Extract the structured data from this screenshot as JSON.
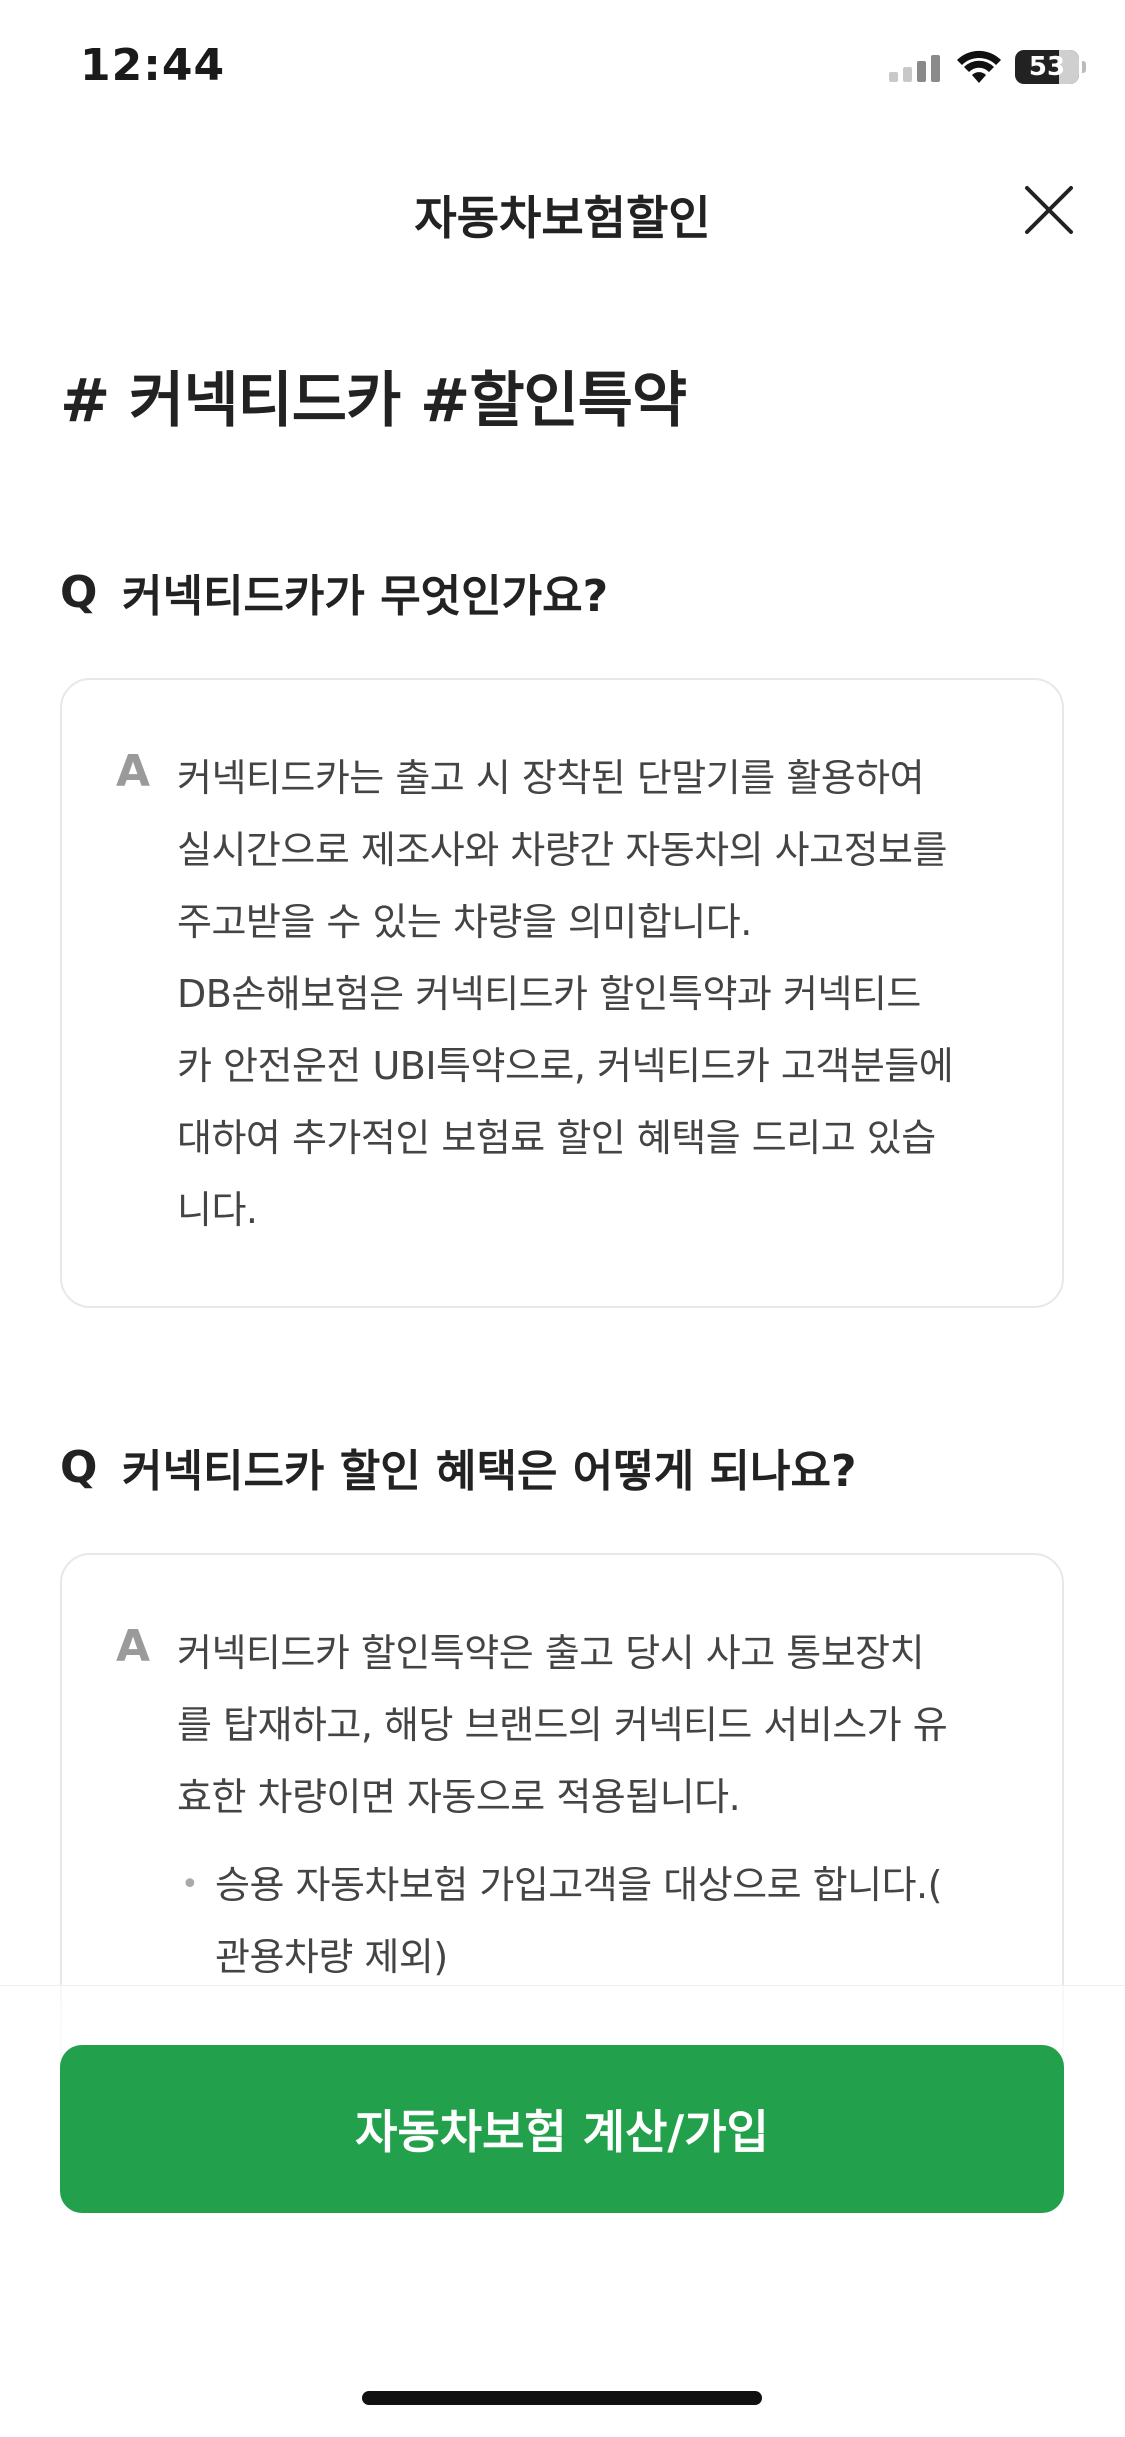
{
  "status_bar": {
    "time": "12:44",
    "battery": "53"
  },
  "header": {
    "title": "자동차보험할인"
  },
  "hashtags": "# 커넥티드카 #할인특약",
  "faq": [
    {
      "q_mark": "Q",
      "question": "커넥티드카가 무엇인가요?",
      "a_mark": "A",
      "answer_lines": [
        "커넥티드카는 출고 시 장착된 단말기를 활용하여",
        "실시간으로 제조사와 차량간 자동차의 사고정보를",
        "주고받을 수 있는 차량을 의미합니다.",
        "DB손해보험은 커넥티드카 할인특약과 커넥티드",
        "카 안전운전 UBI특약으로, 커넥티드카 고객분들에",
        "대하여 추가적인 보험료 할인 혜택을 드리고 있습",
        "니다."
      ]
    },
    {
      "q_mark": "Q",
      "question": "커넥티드카 할인 혜택은 어떻게 되나요?",
      "a_mark": "A",
      "answer_lines": [
        "커넥티드카 할인특약은 출고 당시 사고 통보장치",
        "를 탑재하고, 해당 브랜드의 커넥티드 서비스가 유",
        "효한 차량이면 자동으로 적용됩니다."
      ],
      "bullet_lines": [
        "승용 자동차보험 가입고객을 대상으로 합니다.(",
        "관용차량 제외)"
      ]
    }
  ],
  "cta": {
    "label": "자동차보험 계산/가입"
  },
  "colors": {
    "primary": "#22a04b",
    "text": "#222222",
    "muted": "#9a9a9a",
    "border": "#e8e8e8"
  }
}
